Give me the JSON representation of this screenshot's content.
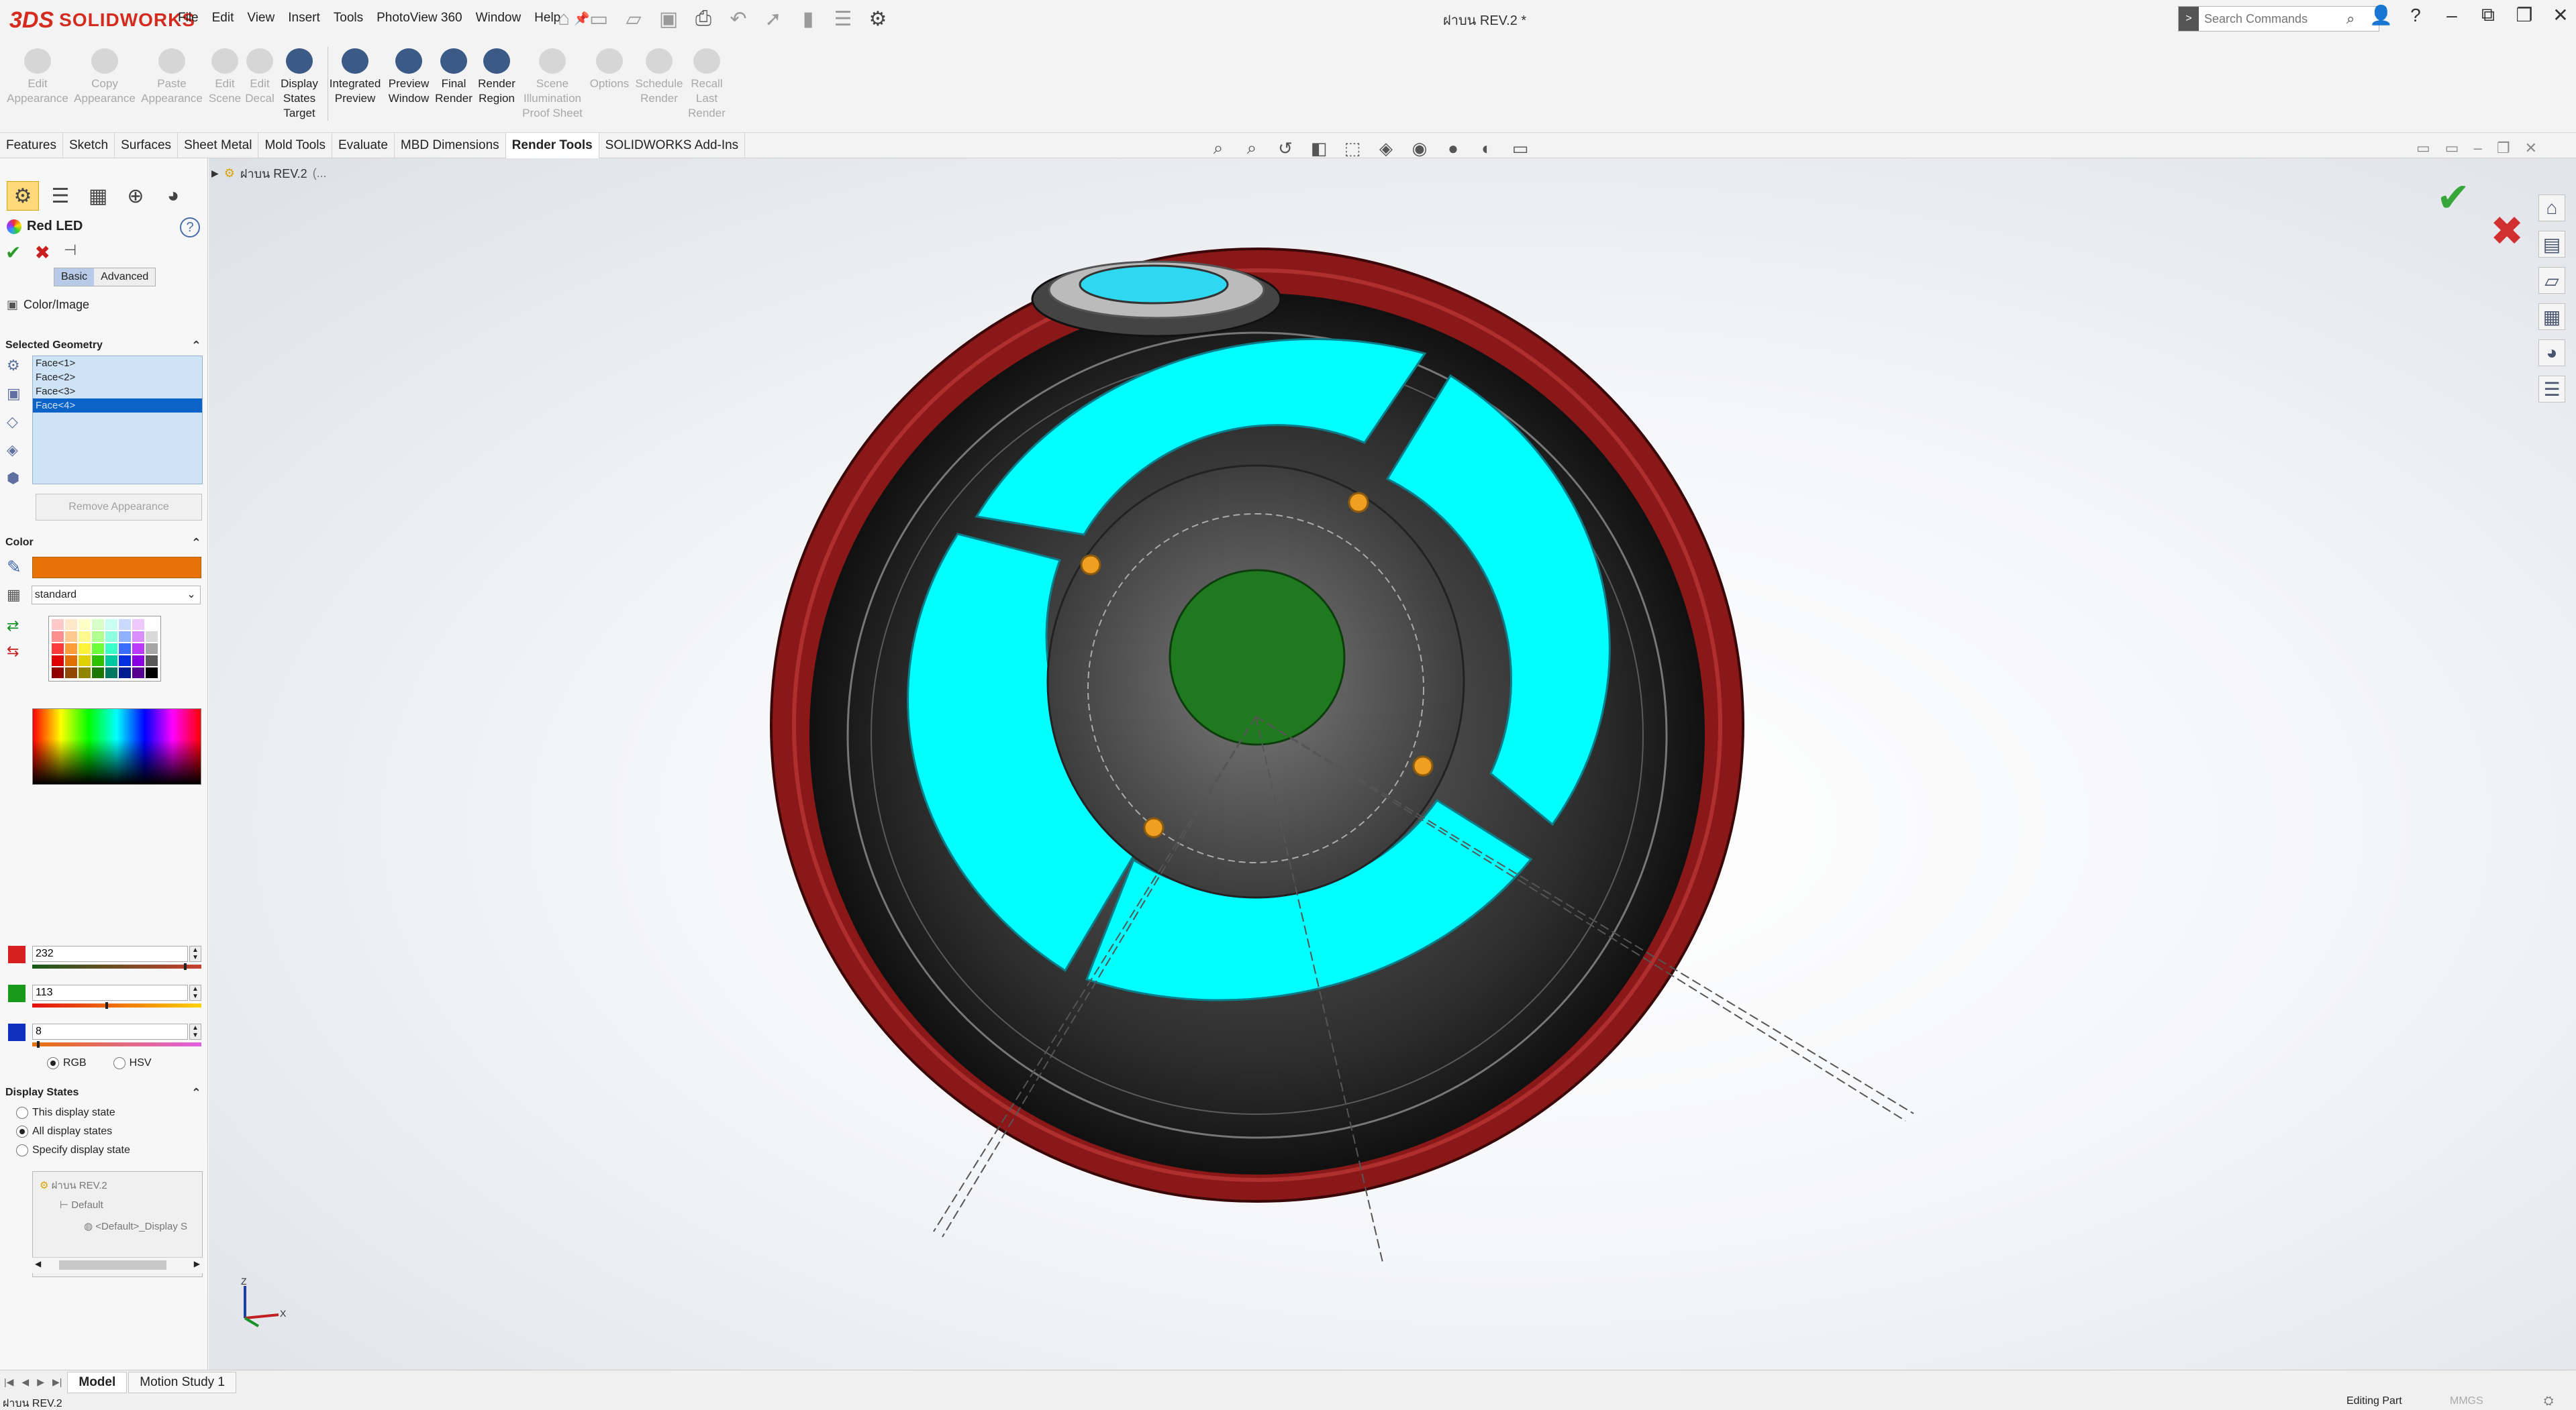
{
  "app": {
    "logo_mark": "3DS",
    "logo_text": "SOLIDWORKS",
    "document_title": "ฝาบน REV.2 *"
  },
  "menu": [
    "File",
    "Edit",
    "View",
    "Insert",
    "Tools",
    "PhotoView 360",
    "Window",
    "Help"
  ],
  "search": {
    "placeholder": "Search Commands"
  },
  "ribbon": [
    {
      "label": "Edit\nAppearance",
      "enabled": false
    },
    {
      "label": "Copy\nAppearance",
      "enabled": false
    },
    {
      "label": "Paste\nAppearance",
      "enabled": false
    },
    {
      "label": "Edit\nScene",
      "enabled": false
    },
    {
      "label": "Edit\nDecal",
      "enabled": false
    },
    {
      "label": "Display\nStates\nTarget",
      "enabled": true
    },
    {
      "label": "Integrated\nPreview",
      "enabled": true
    },
    {
      "label": "Preview\nWindow",
      "enabled": true
    },
    {
      "label": "Final\nRender",
      "enabled": true
    },
    {
      "label": "Render\nRegion",
      "enabled": true
    },
    {
      "label": "Scene\nIllumination\nProof Sheet",
      "enabled": false
    },
    {
      "label": "Options",
      "enabled": false
    },
    {
      "label": "Schedule\nRender",
      "enabled": false
    },
    {
      "label": "Recall\nLast\nRender",
      "enabled": false
    }
  ],
  "tabs": [
    "Features",
    "Sketch",
    "Surfaces",
    "Sheet Metal",
    "Mold Tools",
    "Evaluate",
    "MBD Dimensions",
    "Render Tools",
    "SOLIDWORKS Add-Ins"
  ],
  "active_tab": "Render Tools",
  "tree_flyout": {
    "label": "ฝาบน REV.2",
    "suffix": "(..."
  },
  "property_manager": {
    "title": "Red LED",
    "help": "?",
    "modes": [
      "Basic",
      "Advanced"
    ],
    "active_mode": "Basic",
    "color_image_label": "Color/Image",
    "selected_geometry": {
      "header": "Selected Geometry",
      "items": [
        "Face<1>",
        "Face<2>",
        "Face<3>",
        "Face<4>"
      ],
      "highlighted_index": 3,
      "remove_label": "Remove Appearance"
    },
    "color": {
      "header": "Color",
      "swatch": "#e87108",
      "palette": "standard",
      "r": "232",
      "g": "113",
      "b": "8",
      "r_level": 0.91,
      "g_level": 0.44,
      "b_level": 0.03,
      "mode_rgb": "RGB",
      "mode_hsv": "HSV",
      "selected_mode": "RGB"
    },
    "display_states": {
      "header": "Display States",
      "options": [
        "This display state",
        "All display states",
        "Specify display state"
      ],
      "selected_index": 1,
      "tree": [
        "ฝาบน REV.2",
        "Default",
        "<Default>_Display S"
      ]
    }
  },
  "swatches": [
    "#ffc9c9",
    "#ffe7c9",
    "#fffec9",
    "#d9ffc9",
    "#c9fff1",
    "#c9d9ff",
    "#eec9ff",
    "#ffffff",
    "#ff8f8f",
    "#ffc98f",
    "#fff98f",
    "#b1ff8f",
    "#8fffe1",
    "#8fb1ff",
    "#d98fff",
    "#d9d9d9",
    "#ff3a3a",
    "#ff9d3a",
    "#fff23a",
    "#6dff3a",
    "#3affc8",
    "#3a6dff",
    "#bb3aff",
    "#a6a6a6",
    "#e00000",
    "#e07000",
    "#e0d000",
    "#2fc000",
    "#00c8a0",
    "#0030e0",
    "#8a00e0",
    "#595959",
    "#900000",
    "#904800",
    "#908400",
    "#1e7800",
    "#007860",
    "#001c90",
    "#580090",
    "#000000"
  ],
  "viewport": {
    "rim_color": "#8b1818",
    "body_color": "#2a2a2a",
    "led_color": "#00ffff",
    "hub_color": "#1f7a1f",
    "pin_color": "#f0a020"
  },
  "bottom_tabs": [
    "Model",
    "Motion Study 1"
  ],
  "active_bottom_tab": "Model",
  "status": {
    "left": "ฝาบน REV.2",
    "mode": "Editing Part",
    "units": "MMGS"
  }
}
